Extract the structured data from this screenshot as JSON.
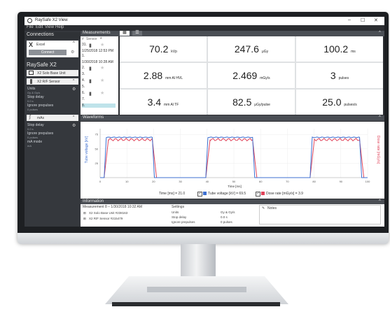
{
  "window": {
    "title": "RaySafe X2 View",
    "min": "–",
    "max": "☐",
    "close": "✕"
  },
  "menu": [
    "File",
    "Edit",
    "View",
    "Help"
  ],
  "sidebar": {
    "connections_title": "Connections",
    "device": "Excel",
    "connect_label": "Connect",
    "raysafe_title": "RaySafe X2",
    "base_unit": "X2 Solo Base Unit",
    "sensor1": {
      "name": "X2 R/F Sensor",
      "settings": [
        {
          "label": "Units",
          "value": "Gy & Gy/s"
        },
        {
          "label": "Stop delay",
          "value": "0.0 s"
        },
        {
          "label": "Ignore prepulses",
          "value": "0 pulses"
        }
      ]
    },
    "sensor2": {
      "name": "mAs",
      "settings": [
        {
          "label": "Stop delay",
          "value": "0.0 s"
        },
        {
          "label": "Ignore prepulses",
          "value": "0 pulses"
        },
        {
          "label": "mA mode",
          "value": "mA"
        }
      ]
    }
  },
  "measurements": {
    "title": "Measurements",
    "columns": [
      "#",
      "Sensor"
    ],
    "entries": [
      "31.",
      "1/25/2018 12:53 PM",
      "1.",
      "1/30/2018 10:28 AM",
      "2.",
      "3.",
      "4.",
      "5.",
      "6.",
      "7.",
      "8."
    ],
    "tiles": [
      {
        "value": "70.2",
        "unit": "kVp"
      },
      {
        "value": "247.6",
        "unit": "μGy"
      },
      {
        "value": "100.2",
        "unit": "ms"
      },
      {
        "value": "2.88",
        "unit": "mm Al HVL"
      },
      {
        "value": "2.469",
        "unit": "mGy/s"
      },
      {
        "value": "3",
        "unit": "pulses"
      },
      {
        "value": "3.4",
        "unit": "mm Al TF"
      },
      {
        "value": "82.5",
        "unit": "μGy/pulse"
      },
      {
        "value": "25.0",
        "unit": "pulses/s"
      }
    ]
  },
  "waveforms": {
    "title": "Waveforms",
    "ylabel_left": "Tube voltage [kV]",
    "ylabel_right": "Dose rate [mGy/s]",
    "xlabel": "Time [ms]",
    "y_ticks": [
      "75",
      "50",
      "25"
    ],
    "x_ticks": [
      "0",
      "10",
      "20",
      "30",
      "40",
      "50",
      "60",
      "70",
      "80",
      "90",
      "100"
    ],
    "cursor": "Time [ms] = 21.0",
    "legend1": "Tube voltage [kV] = 69.5",
    "legend2": "Dose rate [mGy/s] = 3.9",
    "colors": {
      "voltage": "#3d6fd1",
      "dose": "#e0445a"
    }
  },
  "information": {
    "title": "Information",
    "measurement": "Measurement 8 – 1/30/2018 10:32 AM",
    "devices": [
      "X2 Solo Base Unit #238163",
      "X2 R/F Sensor #215479"
    ],
    "settings_title": "Settings",
    "settings": [
      {
        "label": "Units",
        "value": "Gy & Gy/s"
      },
      {
        "label": "Stop delay",
        "value": "0.0 s"
      },
      {
        "label": "Ignore prepulses",
        "value": "0 pulses"
      }
    ],
    "notes_title": "Notes"
  }
}
